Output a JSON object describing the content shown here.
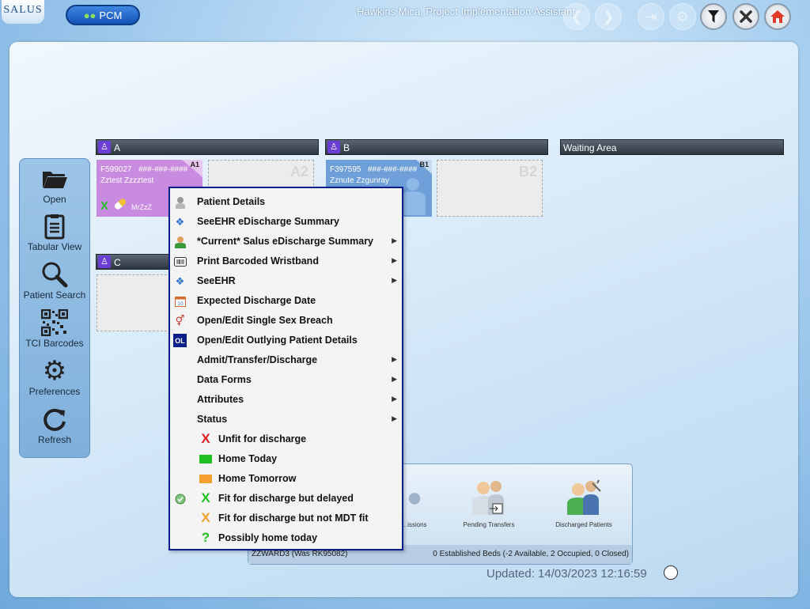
{
  "header": {
    "logo_text": "SALUS",
    "pcm_label": "PCM",
    "user_title": "Hawkins Mica, Project Implementation Assistant"
  },
  "sidebar": {
    "items": [
      {
        "label": "Open"
      },
      {
        "label": "Tabular View"
      },
      {
        "label": "Patient Search"
      },
      {
        "label": "TCI Barcodes"
      },
      {
        "label": "Preferences"
      },
      {
        "label": "Refresh"
      }
    ]
  },
  "bays": {
    "a": {
      "title": "A",
      "bed1": {
        "id": "A1",
        "number": "F599027",
        "nhs": "###-###-####",
        "name": "Zztest Zzzztest",
        "tag": "MrZzZ"
      },
      "bed2": {
        "id": "A2"
      }
    },
    "b": {
      "title": "B",
      "bed1": {
        "id": "B1",
        "number": "F397595",
        "nhs": "###-###-####",
        "name": "Zznute Zzgunray"
      },
      "bed2": {
        "id": "B2"
      }
    },
    "c": {
      "title": "C"
    },
    "waiting": {
      "title": "Waiting Area"
    }
  },
  "context_menu": {
    "items": [
      {
        "label": "Patient Details"
      },
      {
        "label": "SeeEHR eDischarge Summary"
      },
      {
        "label": "*Current* Salus eDischarge Summary"
      },
      {
        "label": "Print Barcoded Wristband"
      },
      {
        "label": "SeeEHR"
      },
      {
        "label": "Expected Discharge Date"
      },
      {
        "label": "Open/Edit Single Sex Breach"
      },
      {
        "label": "Open/Edit Outlying Patient Details"
      },
      {
        "label": "Admit/Transfer/Discharge"
      },
      {
        "label": "Data Forms"
      },
      {
        "label": "Attributes"
      },
      {
        "label": "Status"
      },
      {
        "label": "Unfit for discharge"
      },
      {
        "label": "Home Today"
      },
      {
        "label": "Home Tomorrow"
      },
      {
        "label": "Fit for discharge but delayed"
      },
      {
        "label": "Fit for discharge but not MDT fit"
      },
      {
        "label": "Possibly home today"
      }
    ],
    "outlying_icon_text": "OL"
  },
  "bottom_panel": {
    "tiles": [
      {
        "label": "...issions"
      },
      {
        "label": "Pending Transfers"
      },
      {
        "label": "Discharged Patients"
      }
    ],
    "ward_name": "ZZWARD3 (Was RK95082)",
    "bed_summary": "0 Established Beds (-2 Available, 2 Occupied, 0 Closed)"
  },
  "footer": {
    "updated_text": "Updated: 14/03/2023 12:16:59"
  },
  "colors": {
    "accent": "#0b1f8a",
    "bed_a1": "#c98be0",
    "bed_b1": "#6f9fd8",
    "bay_badge": "#6b3fd4",
    "status_red": "#e02020",
    "status_green": "#20c020",
    "status_orange": "#f5a030"
  },
  "icons": {
    "pcm": "people-icon",
    "back": "arrow-left-icon",
    "forward": "arrow-right-icon",
    "exit": "exit-icon",
    "settings": "gear-icon",
    "filter": "filter-icon",
    "close": "close-icon",
    "home": "home-icon"
  }
}
